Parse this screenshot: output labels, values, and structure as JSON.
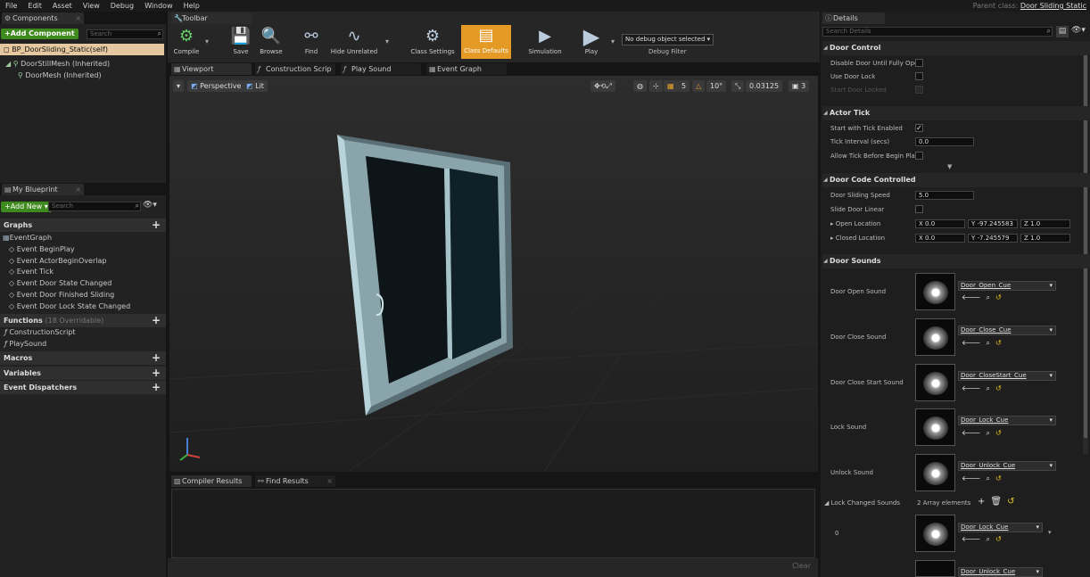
{
  "menubar": {
    "items": [
      "File",
      "Edit",
      "Asset",
      "View",
      "Debug",
      "Window",
      "Help"
    ],
    "parent_class_label": "Parent class:",
    "parent_class_value": "Door Sliding Static"
  },
  "components": {
    "tab_label": "Components",
    "add_button": "+Add Component",
    "search_placeholder": "Search",
    "self_item": "BP_DoorSliding_Static(self)",
    "tree": [
      "DoorStillMesh (Inherited)",
      "DoorMesh (Inherited)"
    ]
  },
  "my_blueprint": {
    "tab_label": "My Blueprint",
    "add_button": "+Add New",
    "search_placeholder": "Search",
    "graphs_label": "Graphs",
    "event_graph_label": "EventGraph",
    "events": [
      "Event BeginPlay",
      "Event ActorBeginOverlap",
      "Event Tick",
      "Event Door State Changed",
      "Event Door Finished Sliding",
      "Event Door Lock State Changed"
    ],
    "functions_label": "Functions",
    "functions_note": "(18 Overridable)",
    "functions": [
      "ConstructionScript",
      "PlaySound"
    ],
    "macros_label": "Macros",
    "variables_label": "Variables",
    "dispatchers_label": "Event Dispatchers"
  },
  "toolbar": {
    "tab_label": "Toolbar",
    "buttons": [
      "Compile",
      "Save",
      "Browse",
      "Find",
      "Hide Unrelated",
      "Class Settings",
      "Class Defaults",
      "Simulation",
      "Play"
    ],
    "debug_select": "No debug object selected",
    "debug_filter_label": "Debug Filter"
  },
  "editor_tabs": [
    "Viewport",
    "Construction Scrip",
    "Play Sound",
    "Event Graph"
  ],
  "viewport": {
    "perspective_label": "Perspective",
    "lit_label": "Lit",
    "snap_grid": "5",
    "snap_angle": "10°",
    "snap_scale": "0.03125",
    "camera_speed": "3"
  },
  "bottom": {
    "tabs": [
      "Compiler Results",
      "Find Results"
    ],
    "clear_label": "Clear"
  },
  "details": {
    "tab_label": "Details",
    "search_placeholder": "Search Details",
    "door_control": {
      "title": "Door Control",
      "rows": [
        "Disable Door Until Fully Oper",
        "Use Door Lock",
        "Start Door Locked"
      ]
    },
    "actor_tick": {
      "title": "Actor Tick",
      "start_with_tick": "Start with Tick Enabled",
      "tick_interval": "Tick Interval (secs)",
      "tick_interval_value": "0.0",
      "allow_tick": "Allow Tick Before Begin Play"
    },
    "door_code": {
      "title": "Door Code Controlled",
      "speed_label": "Door Sliding Speed",
      "speed_value": "5.0",
      "linear_label": "Slide Door Linear",
      "open_label": "Open Location",
      "open_x": "0.0",
      "open_y": "-97.245583",
      "open_z": "1.0",
      "closed_label": "Closed Location",
      "closed_x": "0.0",
      "closed_y": "-7.245579",
      "closed_z": "1.0"
    },
    "door_sounds": {
      "title": "Door Sounds",
      "sounds": [
        {
          "label": "Door Open Sound",
          "cue": "Door_Open_Cue"
        },
        {
          "label": "Door Close Sound",
          "cue": "Door_Close_Cue"
        },
        {
          "label": "Door Close Start Sound",
          "cue": "Door_CloseStart_Cue"
        },
        {
          "label": "Lock Sound",
          "cue": "Door_Lock_Cue"
        },
        {
          "label": "Unlock Sound",
          "cue": "Door_Unlock_Cue"
        }
      ],
      "lock_changed_label": "Lock Changed Sounds",
      "array_elements": "2 Array elements",
      "array_index": "0",
      "array_cues": [
        "Door_Lock_Cue",
        "Door_Unlock_Cue"
      ]
    }
  }
}
